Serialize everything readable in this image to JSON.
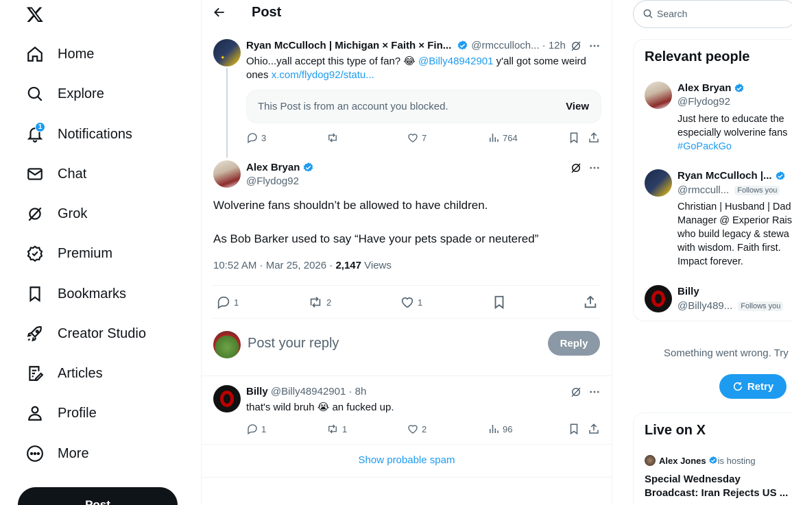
{
  "nav": {
    "items": [
      {
        "label": "Home",
        "icon": "home-icon"
      },
      {
        "label": "Explore",
        "icon": "search-icon"
      },
      {
        "label": "Notifications",
        "icon": "bell-icon",
        "badge": "1"
      },
      {
        "label": "Chat",
        "icon": "mail-icon"
      },
      {
        "label": "Grok",
        "icon": "grok-icon"
      },
      {
        "label": "Premium",
        "icon": "verified-badge-icon"
      },
      {
        "label": "Bookmarks",
        "icon": "bookmark-icon"
      },
      {
        "label": "Creator Studio",
        "icon": "rocket-icon"
      },
      {
        "label": "Articles",
        "icon": "article-icon"
      },
      {
        "label": "Profile",
        "icon": "person-icon"
      },
      {
        "label": "More",
        "icon": "more-circle-icon"
      }
    ],
    "post_button": "Post"
  },
  "header": {
    "title": "Post"
  },
  "parent_post": {
    "name": "Ryan McCulloch | Michigan × Faith × Fin...",
    "handle": "@rmcculloch...",
    "time": "· 12h",
    "text_prefix": "Ohio...yall accept this type of fan? 😂 ",
    "mention": "@Billy48942901",
    "text_suffix": "  y'all got some weird ones ",
    "link": "x.com/flydog92/statu...",
    "blocked_notice": "This Post is from an account you blocked.",
    "view_label": "View",
    "replies": "3",
    "reposts": "",
    "likes": "7",
    "views": "764"
  },
  "main_post": {
    "name": "Alex Bryan",
    "handle": "@Flydog92",
    "line1": "Wolverine fans shouldn’t be allowed to have children.",
    "line2": "As Bob Barker used to say “Have your pets spade or neutered”",
    "timestamp": "10:52 AM · Mar 25, 2026 · ",
    "views_count": "2,147",
    "views_label": " Views",
    "replies": "1",
    "reposts": "2",
    "likes": "1"
  },
  "reply_box": {
    "placeholder": "Post your reply",
    "button": "Reply"
  },
  "reply": {
    "name": "Billy",
    "handle": "@Billy48942901",
    "time": "· 8h",
    "text": "that's wild bruh 😭 an fucked up.",
    "replies": "1",
    "reposts": "1",
    "likes": "2",
    "views": "96"
  },
  "spam_link": "Show probable spam",
  "search": {
    "placeholder": "Search"
  },
  "relevant": {
    "title": "Relevant people",
    "people": [
      {
        "name": "Alex Bryan",
        "handle": "@Flydog92",
        "bio1": "Just here to educate the",
        "bio2": "especially wolverine fans",
        "hashtag": "#GoPackGo"
      },
      {
        "name": "Ryan McCulloch |...",
        "handle": "@rmccull...",
        "follows": "Follows you",
        "bio1": "Christian | Husband | Dad",
        "bio2": "Manager @ Experior Raise",
        "bio3": "who build legacy & stewa",
        "bio4": "with wisdom. Faith first.",
        "bio5": "Impact forever."
      },
      {
        "name": "Billy",
        "handle": "@Billy489...",
        "follows": "Follows you"
      }
    ]
  },
  "error": {
    "text": "Something went wrong. Try",
    "retry": "Retry"
  },
  "live": {
    "title": "Live on X",
    "host": "Alex Jones",
    "hosting": " is hosting",
    "line1": "Special Wednesday",
    "line2": "Broadcast: Iran Rejects US ..."
  }
}
